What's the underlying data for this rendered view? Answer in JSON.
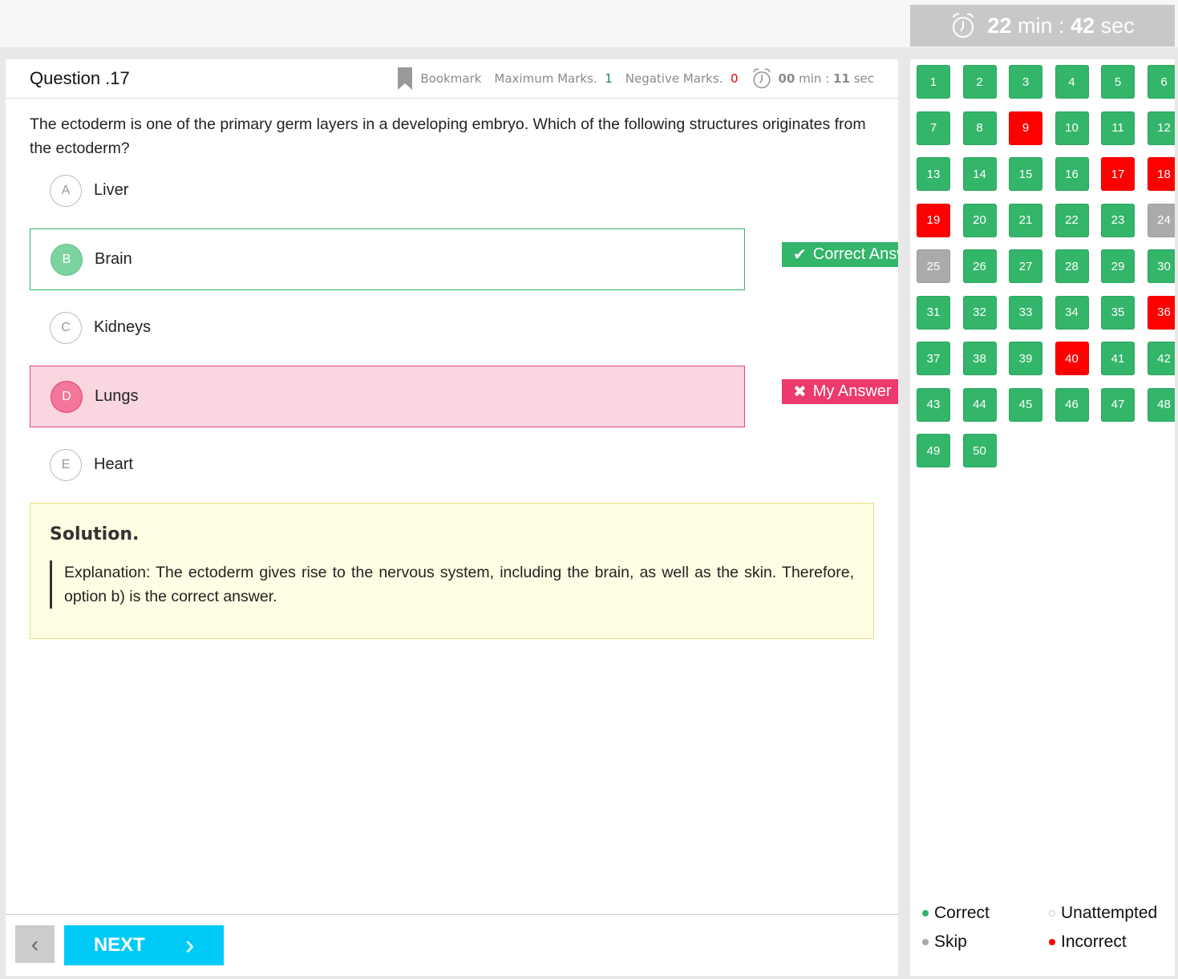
{
  "header": {
    "timer_min": "22",
    "timer_min_label": "min :",
    "timer_sec": "42",
    "timer_sec_label": "sec",
    "timer_icon": "alarm-clock-icon"
  },
  "question": {
    "title": "Question .17",
    "bookmark": "Bookmark",
    "max_marks_label": "Maximum Marks.",
    "max_marks": "1",
    "neg_marks_label": "Negative Marks.",
    "neg_marks": "0",
    "q_timer_min": "00",
    "q_timer_rest": "min :",
    "q_timer_sec": "11",
    "q_timer_sec_label": "sec",
    "text": "The ectoderm is one of the primary germ layers in a developing embryo. Which of the following structures originates from the ectoderm?",
    "options": [
      {
        "letter": "A",
        "text": "Liver"
      },
      {
        "letter": "B",
        "text": "Brain"
      },
      {
        "letter": "C",
        "text": "Kidneys"
      },
      {
        "letter": "D",
        "text": "Lungs"
      },
      {
        "letter": "E",
        "text": "Heart"
      }
    ],
    "correct_tag": "Correct Answer",
    "my_answer_tag": "My Answer"
  },
  "solution": {
    "title": "Solution.",
    "text": "Explanation: The ectoderm gives rise to the nervous system, including the brain, as well as the skin. Therefore, option b) is the correct answer."
  },
  "footer": {
    "next": "NEXT"
  },
  "colors": {
    "correct": "#33b56a",
    "incorrect": "#ff0000",
    "skip": "#aaaaaa",
    "accent": "#00cbf7"
  },
  "palette": [
    "correct",
    "correct",
    "correct",
    "correct",
    "correct",
    "correct",
    "correct",
    "correct",
    "incorrect",
    "correct",
    "correct",
    "correct",
    "correct",
    "correct",
    "correct",
    "correct",
    "incorrect",
    "incorrect",
    "incorrect",
    "correct",
    "correct",
    "correct",
    "correct",
    "skip",
    "skip",
    "correct",
    "correct",
    "correct",
    "correct",
    "correct",
    "correct",
    "correct",
    "correct",
    "correct",
    "correct",
    "incorrect",
    "correct",
    "correct",
    "correct",
    "incorrect",
    "correct",
    "correct",
    "correct",
    "correct",
    "correct",
    "correct",
    "correct",
    "correct",
    "correct",
    "correct"
  ],
  "legend": {
    "correct": "Correct",
    "unattempted": "Unattempted",
    "skip": "Skip",
    "incorrect": "Incorrect"
  }
}
